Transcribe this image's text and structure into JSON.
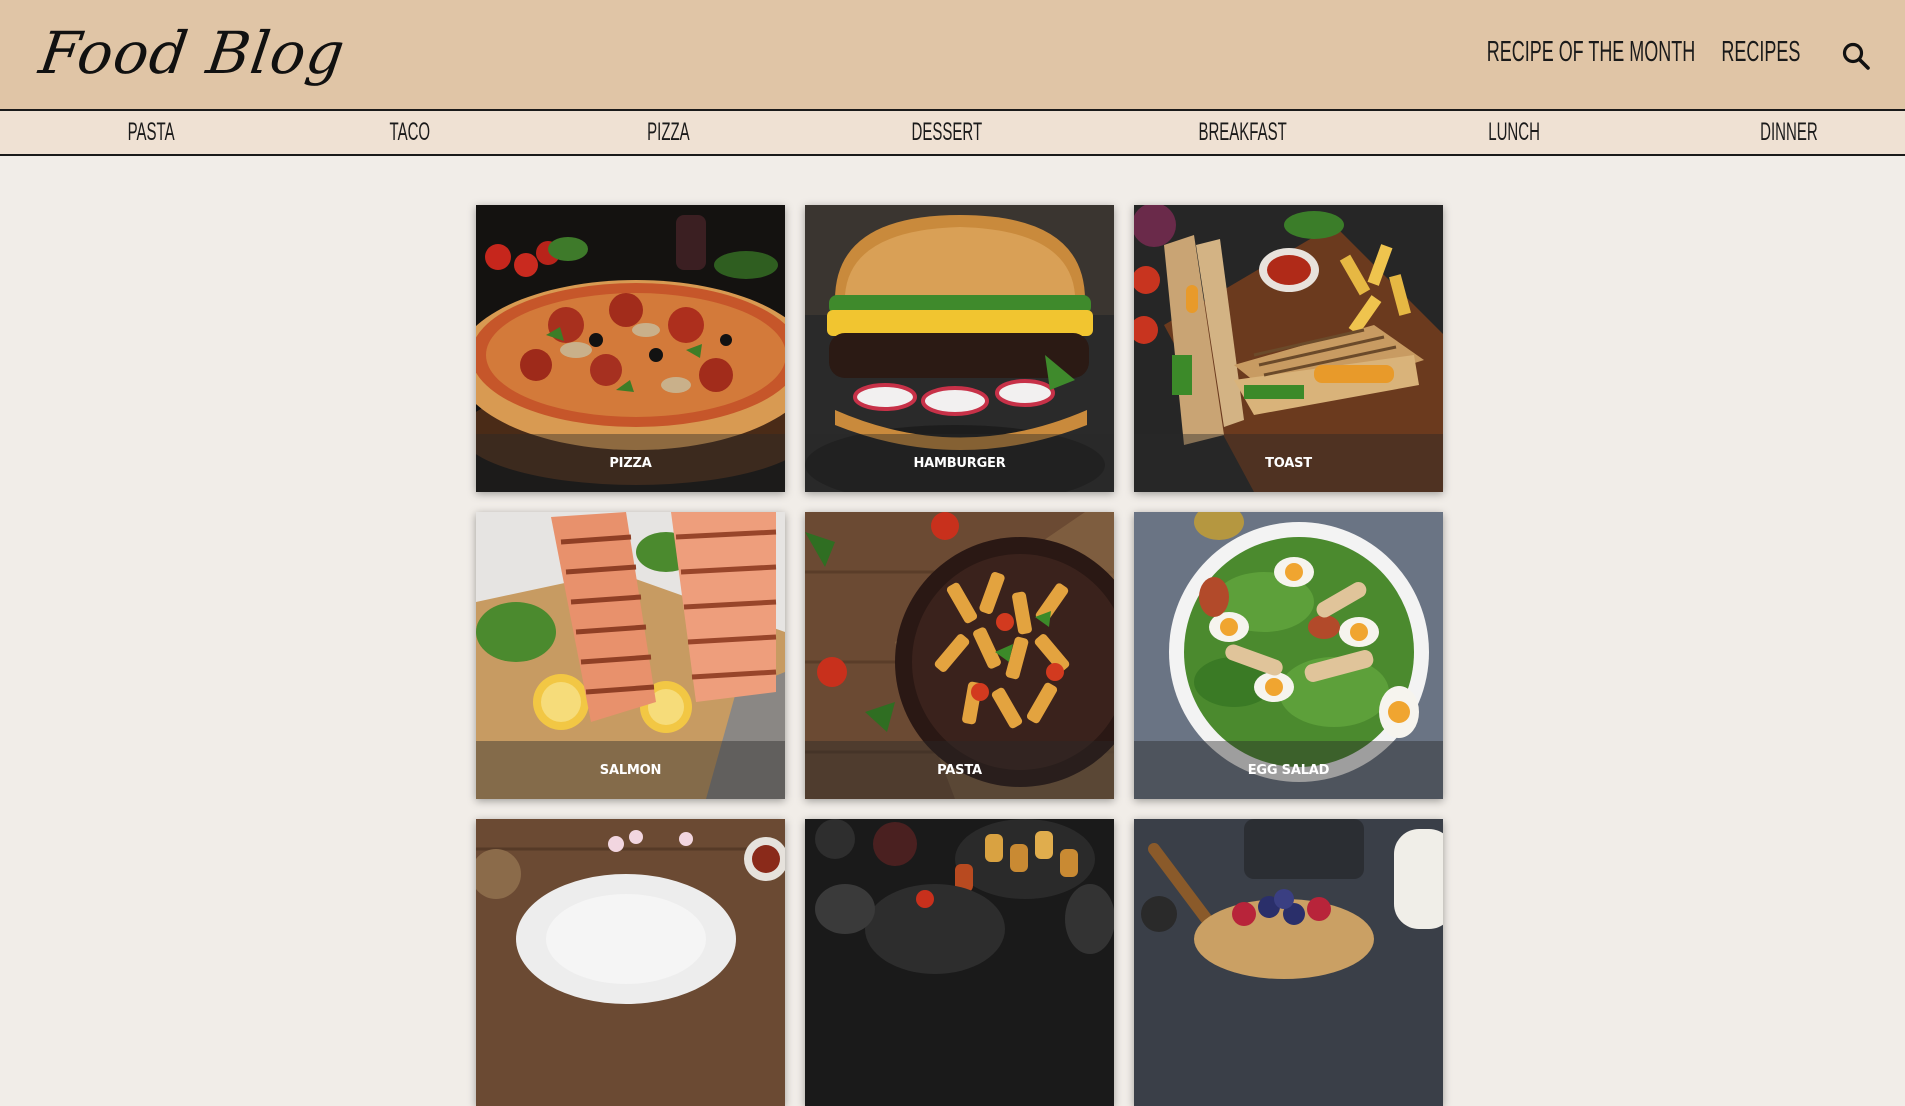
{
  "header": {
    "logo": "Food Blog",
    "nav": {
      "recipe_of_month": "RECIPE OF THE MONTH",
      "recipes": "RECIPES"
    },
    "search_icon": "search-icon"
  },
  "categories": [
    "PASTA",
    "TACO",
    "PIZZA",
    "DESSERT",
    "BREAKFAST",
    "LUNCH",
    "DINNER"
  ],
  "cards": [
    {
      "title": "PIZZA"
    },
    {
      "title": "HAMBURGER"
    },
    {
      "title": "TOAST"
    },
    {
      "title": "SALMON"
    },
    {
      "title": "PASTA"
    },
    {
      "title": "EGG SALAD"
    }
  ],
  "colors": {
    "header_bg": "#e0c5a6",
    "category_bg": "#efe1d3",
    "page_bg": "#f1ede8"
  }
}
